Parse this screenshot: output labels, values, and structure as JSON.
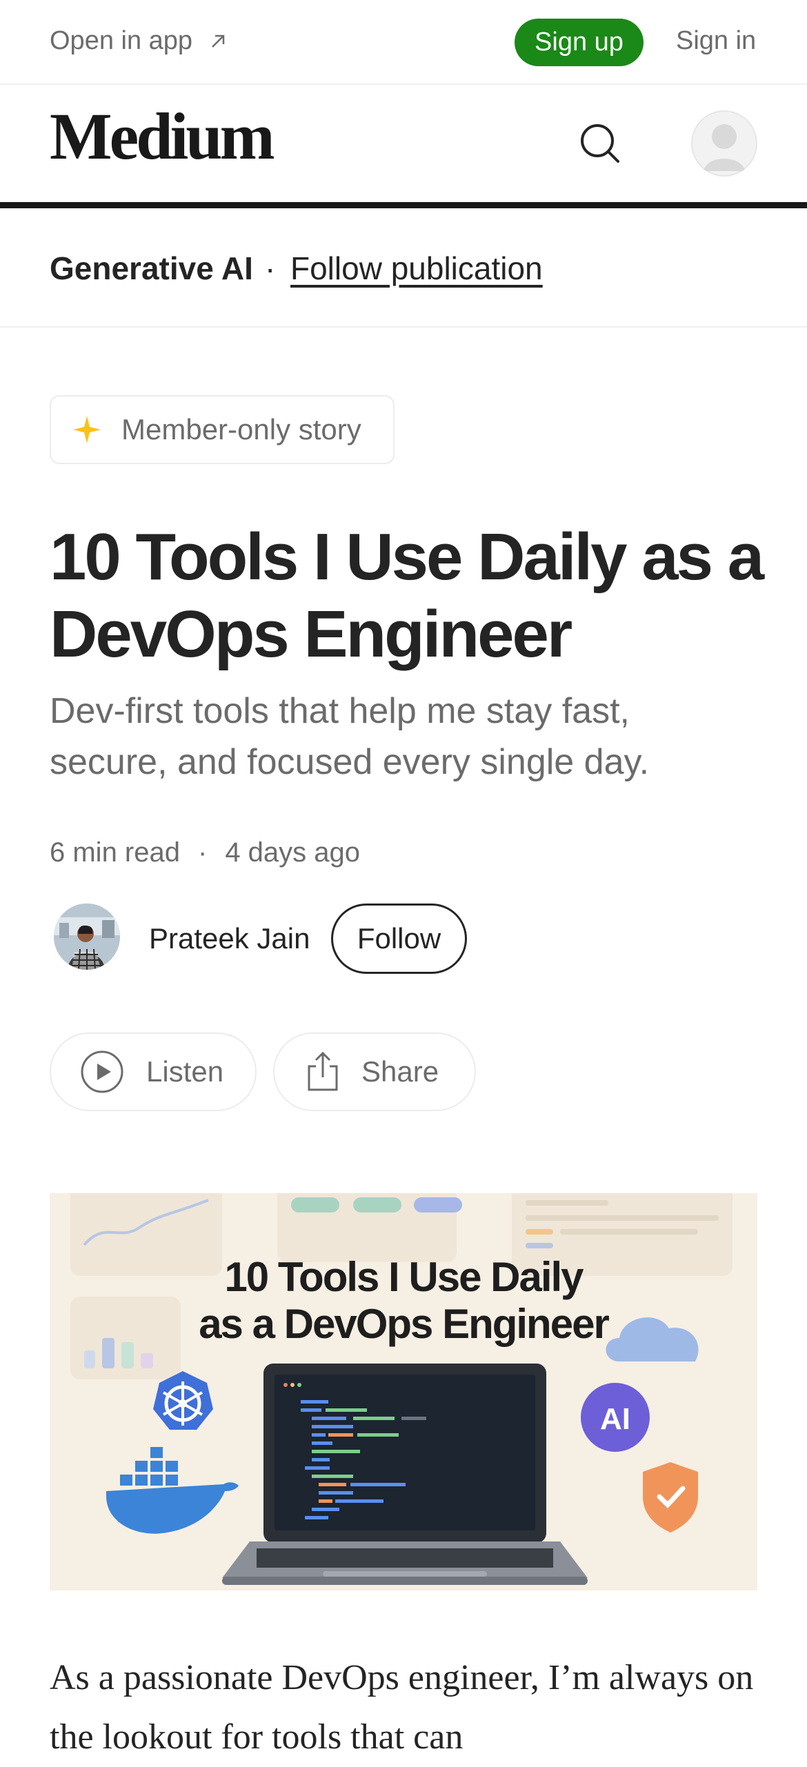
{
  "topbar": {
    "open_in_app": "Open in app",
    "signup": "Sign up",
    "signin": "Sign in"
  },
  "header": {
    "logo": "Medium"
  },
  "publication": {
    "name": "Generative AI",
    "separator": "·",
    "follow": "Follow publication"
  },
  "badge": {
    "label": "Member-only story",
    "icon_color": "#ffc017"
  },
  "article": {
    "title": "10 Tools I Use Daily as a DevOps Engineer",
    "subtitle": "Dev-first tools that help me stay fast, secure, and focused every single day.",
    "read_time": "6 min read",
    "meta_separator": "·",
    "posted": "4 days ago",
    "author": "Prateek Jain",
    "follow": "Follow",
    "listen": "Listen",
    "share": "Share",
    "hero_title_line1": "10 Tools I Use Daily",
    "hero_title_line2": "as a DevOps Engineer",
    "hero_ai_badge": "AI",
    "body": "As a passionate DevOps engineer, I’m always on the lookout for tools that can"
  },
  "colors": {
    "brand_green": "#1a8917",
    "text": "#242424",
    "muted": "#6b6b6b"
  },
  "icons": [
    "external-link-icon",
    "search-icon",
    "user-avatar-icon",
    "sparkle-icon",
    "play-icon",
    "share-icon"
  ]
}
